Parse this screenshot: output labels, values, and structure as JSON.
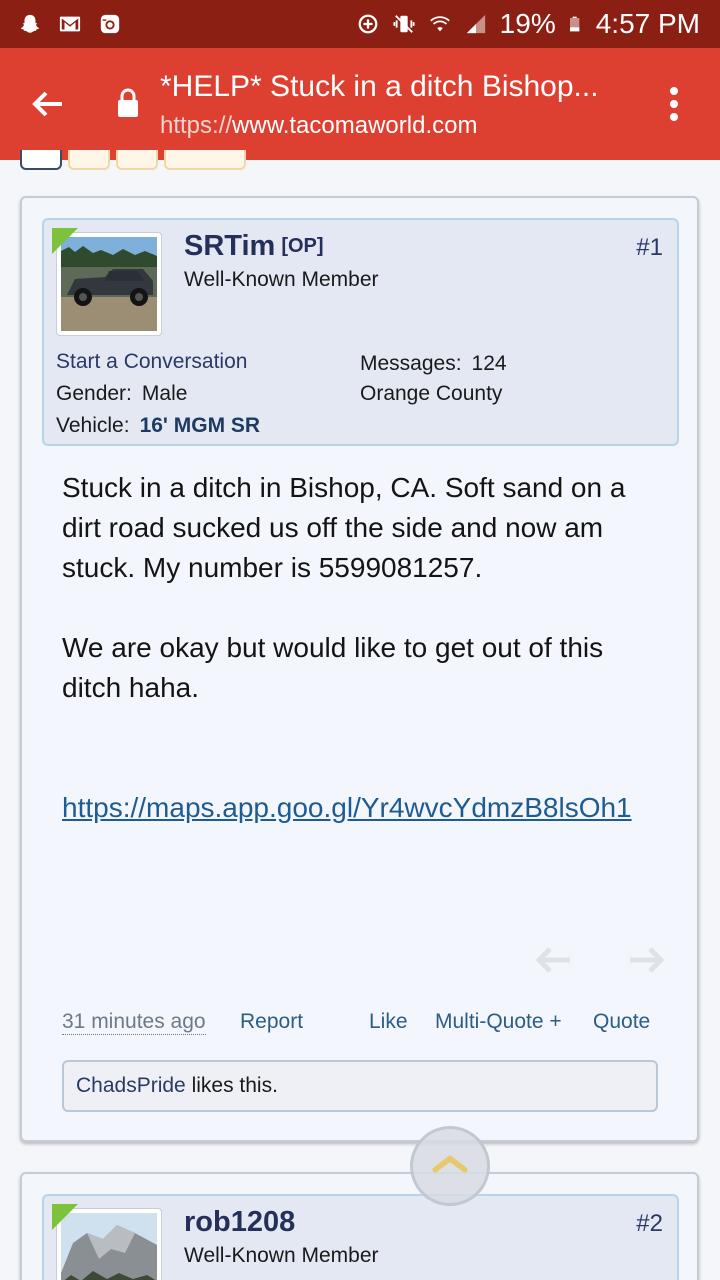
{
  "status_bar": {
    "battery": "19%",
    "time": "4:57 PM",
    "icons": [
      "snapchat-icon",
      "gmail-icon",
      "instagram-icon",
      "data-saver-icon",
      "vibrate-icon",
      "wifi-icon",
      "signal-icon",
      "battery-icon"
    ]
  },
  "browser": {
    "page_title": "*HELP* Stuck in a ditch Bishop...",
    "url_scheme": "https://",
    "url_host": "www.tacomaworld.com",
    "icons": [
      "back-arrow-icon",
      "lock-icon",
      "more-vert-icon"
    ]
  },
  "post1": {
    "number": "#1",
    "username": "SRTim",
    "op_tag": "[OP]",
    "user_title": "Well-Known Member",
    "start_conversation": "Start a Conversation",
    "messages_label": "Messages:",
    "messages_value": "124",
    "location": "Orange County",
    "gender_label": "Gender:",
    "gender_value": "Male",
    "vehicle_label": "Vehicle:",
    "vehicle_value": "16' MGM SR",
    "body_paragraph_1": "Stuck in a ditch in Bishop, CA. Soft sand on a dirt road sucked us off the side and now am stuck. My number is 5599081257.",
    "body_paragraph_2": "We are okay but would like to get out of this ditch haha.",
    "link": "https://maps.app.goo.gl/Yr4wvcYdmzB8lsOh1",
    "timestamp": "31 minutes ago",
    "report": "Report",
    "like": "Like",
    "multi_quote": "Multi-Quote +",
    "quote": "Quote",
    "liker": "ChadsPride",
    "likes_suffix": " likes this."
  },
  "post2": {
    "number": "#2",
    "username": "rob1208",
    "user_title": "Well-Known Member"
  }
}
